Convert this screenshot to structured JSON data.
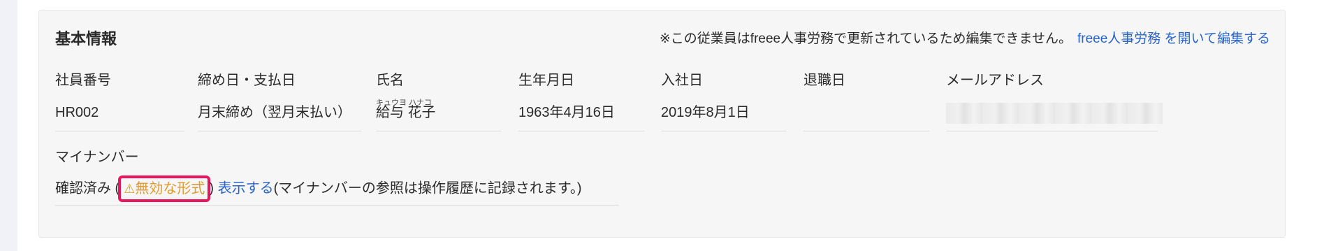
{
  "card": {
    "title": "基本情報",
    "notice_text": "※この従業員はfreee人事労務で更新されているため編集できません。",
    "notice_link": "freee人事労務 を開いて編集する"
  },
  "fields": {
    "employee_number": {
      "label": "社員番号",
      "value": "HR002"
    },
    "closing_pay_day": {
      "label": "締め日・支払日",
      "value": "月末締め（翌月末払い）"
    },
    "name": {
      "label": "氏名",
      "value": "給与 花子",
      "reading": "キュウヨ ハナコ"
    },
    "birth_date": {
      "label": "生年月日",
      "value": "1963年4月16日"
    },
    "hire_date": {
      "label": "入社日",
      "value": "2019年8月1日"
    },
    "retirement_date": {
      "label": "退職日",
      "value": ""
    },
    "email": {
      "label": "メールアドレス",
      "value": ""
    }
  },
  "mynumber": {
    "label": "マイナンバー",
    "status": "確認済み (",
    "warning": "無効な形式",
    "close_paren": ")",
    "show_link": "表示する",
    "note": "(マイナンバーの参照は操作履歴に記録されます。)"
  },
  "colors": {
    "link": "#2864c8",
    "warning": "#e3982a",
    "highlight_border": "#e8175d"
  },
  "icons": {
    "warning": "warning-triangle-icon"
  }
}
